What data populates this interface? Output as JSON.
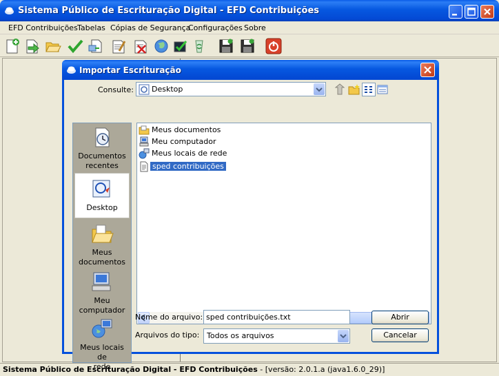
{
  "window": {
    "title": "Sistema Público de Escrituração Digital - EFD Contribuições"
  },
  "menu": {
    "items": [
      "EFD Contribuições",
      "Tabelas",
      "Cópias de Segurança",
      "Configurações",
      "Sobre"
    ]
  },
  "toolbar": {
    "icons": [
      "new-doc-icon",
      "import-arrow-icon",
      "open-folder-icon",
      "check-icon",
      "export-icon",
      "sign-icon",
      "delete-sign-icon",
      "globe-icon",
      "validate-icon",
      "recycle-icon",
      "save-icon",
      "save-as-icon",
      "power-icon"
    ]
  },
  "dialog": {
    "title": "Importar Escrituração",
    "consulte_label": "Consulte:",
    "consulte_value": "Desktop",
    "places": [
      {
        "label_lines": [
          "Documentos",
          "recentes"
        ]
      },
      {
        "label_lines": [
          "Desktop"
        ]
      },
      {
        "label_lines": [
          "Meus",
          "documentos"
        ]
      },
      {
        "label_lines": [
          "Meu",
          "computador"
        ]
      },
      {
        "label_lines": [
          "Meus locais de",
          "rede"
        ]
      }
    ],
    "files": [
      {
        "name": "Meus documentos"
      },
      {
        "name": "Meu computador"
      },
      {
        "name": "Meus locais de rede"
      },
      {
        "name": "sped contribuições"
      }
    ],
    "filename_label": "Nome do arquivo:",
    "filename_value": "sped contribuições.txt",
    "filetype_label": "Arquivos do tipo:",
    "filetype_value": "Todos os arquivos",
    "open_button": "Abrir",
    "cancel_button": "Cancelar"
  },
  "status": {
    "app": "Sistema Público de Escrituração Digital - EFD Contribuições",
    "separator": " - ",
    "version": "[versão: 2.0.1.a (java1.6.0_29)]"
  },
  "colors": {
    "titlebar": "#0450dc",
    "selection": "#316ac5",
    "face": "#ece9d8"
  }
}
